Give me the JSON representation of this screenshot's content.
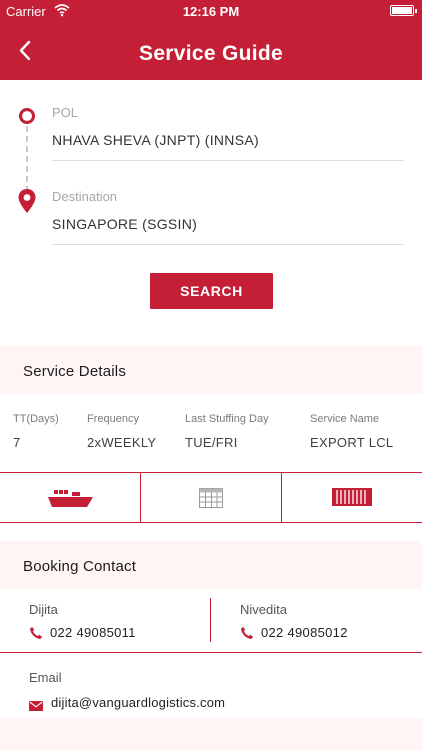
{
  "status_bar": {
    "carrier": "Carrier",
    "time": "12:16 PM"
  },
  "nav": {
    "title": "Service Guide",
    "back_icon": "chevron-left-icon"
  },
  "route": {
    "pol_label": "POL",
    "pol_value": "NHAVA SHEVA (JNPT) (INNSA)",
    "destination_label": "Destination",
    "destination_value": "SINGAPORE (SGSIN)",
    "search_label": "SEARCH"
  },
  "service_details": {
    "heading": "Service Details",
    "columns": [
      {
        "label": "TT(Days)",
        "value": "7"
      },
      {
        "label": "Frequency",
        "value": "2xWEEKLY"
      },
      {
        "label": "Last Stuffing Day",
        "value": "TUE/FRI"
      },
      {
        "label": "Service Name",
        "value": "EXPORT LCL"
      }
    ],
    "icons": [
      "ship-icon",
      "calendar-grid-icon",
      "container-icon"
    ]
  },
  "booking_contact": {
    "heading": "Booking Contact",
    "contacts": [
      {
        "name": "Dijita",
        "phone": "022 49085011"
      },
      {
        "name": "Nivedita",
        "phone": "022 49085012"
      }
    ],
    "email_label": "Email",
    "email_value": "dijita@vanguardlogistics.com"
  },
  "colors": {
    "accent": "#c41f36",
    "section_bg": "#fff5f5",
    "muted_text": "#a6a6a6"
  }
}
